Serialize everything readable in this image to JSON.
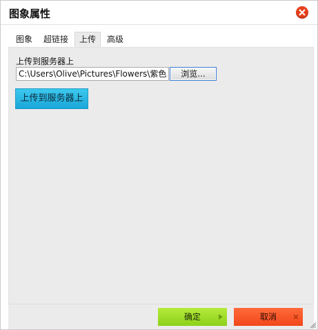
{
  "dialog": {
    "title": "图象属性"
  },
  "tabs": [
    {
      "label": "图象",
      "active": false
    },
    {
      "label": "超链接",
      "active": false
    },
    {
      "label": "上传",
      "active": true
    },
    {
      "label": "高级",
      "active": false
    }
  ],
  "upload": {
    "label": "上传到服务器上",
    "file_value": "C:\\Users\\Olive\\Pictures\\Flowers\\紫色",
    "browse_label": "浏览...",
    "send_label": "上传到服务器上"
  },
  "footer": {
    "ok_label": "确定",
    "cancel_label": "取消"
  },
  "colors": {
    "close": "#e8401d",
    "upload_button": "#2bb8e4",
    "ok_button": "#9edc26",
    "cancel_button": "#f7561f",
    "panel_bg": "#ebebeb"
  },
  "icons": {
    "close": "close-x-icon",
    "ok": "triangle-right-icon",
    "cancel": "small-x-icon",
    "resize": "resize-grip-icon"
  }
}
